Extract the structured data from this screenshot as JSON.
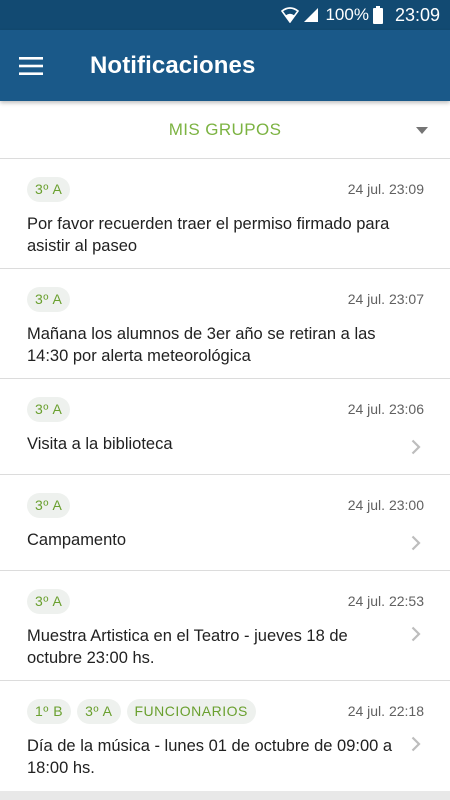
{
  "status_bar": {
    "battery_percent": "100%",
    "time": "23:09",
    "icons": [
      "wifi-icon",
      "signal-icon",
      "battery-icon"
    ]
  },
  "app_bar": {
    "title": "Notificaciones",
    "menu_icon": "hamburger-menu-icon"
  },
  "group_selector": {
    "label": "MIS GRUPOS",
    "icon": "dropdown-arrow-icon"
  },
  "notifications": [
    {
      "groups": [
        "3º A"
      ],
      "time": "24 jul. 23:09",
      "message": "Por favor recuerden traer el permiso firmado para asistir al paseo",
      "has_chevron": false
    },
    {
      "groups": [
        "3º A"
      ],
      "time": "24 jul. 23:07",
      "message": "Mañana los alumnos de 3er año se retiran a las 14:30 por alerta meteorológica",
      "has_chevron": false
    },
    {
      "groups": [
        "3º A"
      ],
      "time": "24 jul. 23:06",
      "message": "Visita a la biblioteca",
      "has_chevron": true
    },
    {
      "groups": [
        "3º A"
      ],
      "time": "24 jul. 23:00",
      "message": "Campamento",
      "has_chevron": true
    },
    {
      "groups": [
        "3º A"
      ],
      "time": "24 jul. 22:53",
      "message": "Muestra Artistica en el Teatro - jueves 18 de octubre 23:00 hs.",
      "has_chevron": true
    },
    {
      "groups": [
        "1º B",
        "3º A",
        "FUNCIONARIOS"
      ],
      "time": "24 jul. 22:18",
      "message": "Día de la música - lunes 01 de octubre de 09:00 a 18:00 hs.",
      "has_chevron": true
    }
  ],
  "colors": {
    "status_bar": "#124a72",
    "app_bar": "#1a5989",
    "accent_green": "#7cb342",
    "badge_bg": "#eef1ee"
  }
}
